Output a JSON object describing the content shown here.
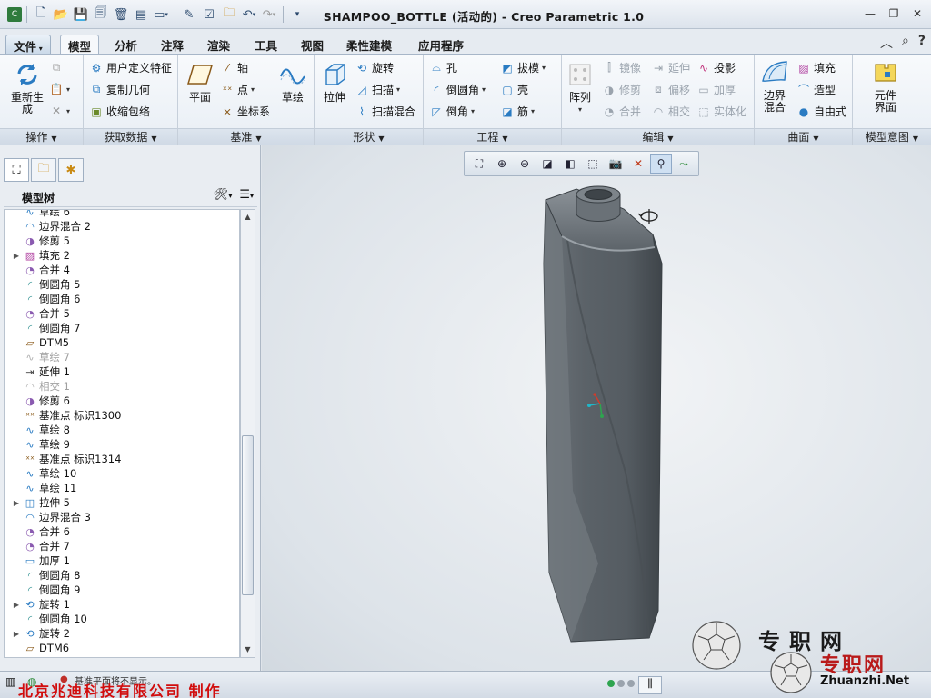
{
  "window": {
    "title": "SHAMPOO_BOTTLE (活动的) - Creo Parametric 1.0"
  },
  "tabs": {
    "file": "文件",
    "items": [
      "模型",
      "分析",
      "注释",
      "渲染",
      "工具",
      "视图",
      "柔性建模",
      "应用程序"
    ],
    "active": "模型"
  },
  "ribbon": {
    "operations": {
      "label": "操作",
      "regen": "重新生\n成"
    },
    "get_data": {
      "label": "获取数据",
      "udf": "用户定义特征",
      "copy_geom": "复制几何",
      "shrinkwrap": "收缩包络"
    },
    "datum": {
      "label": "基准",
      "plane": "平面",
      "axis": "轴",
      "point": "点",
      "csys": "坐标系",
      "sketch": "草绘"
    },
    "shapes": {
      "label": "形状",
      "extrude": "拉伸",
      "revolve": "旋转",
      "sweep": "扫描",
      "swept_blend": "扫描混合"
    },
    "engineering": {
      "label": "工程",
      "hole": "孔",
      "round": "倒圆角",
      "chamfer": "倒角",
      "draft": "拔模",
      "shell": "壳",
      "rib": "筋"
    },
    "editing": {
      "label": "编辑",
      "pattern": "阵列",
      "mirror": "镜像",
      "trim": "修剪",
      "merge": "合并",
      "extend": "延伸",
      "offset": "偏移",
      "intersect": "相交",
      "project": "投影",
      "thicken": "加厚",
      "solidify": "实体化"
    },
    "surfaces": {
      "label": "曲面",
      "boundary_blend": "边界\n混合",
      "fill": "填充",
      "style": "造型",
      "freestyle": "自由式"
    },
    "model_intent": {
      "label": "模型意图",
      "component_interface": "元件\n界面"
    }
  },
  "model_tree": {
    "title": "模型树",
    "items": [
      {
        "label": "草绘 6",
        "icon": "sketch",
        "expand": false,
        "dim": false
      },
      {
        "label": "边界混合 2",
        "icon": "boundary-blend",
        "expand": false,
        "dim": false
      },
      {
        "label": "修剪 5",
        "icon": "trim",
        "expand": false,
        "dim": false
      },
      {
        "label": "填充 2",
        "icon": "fill",
        "expand": true,
        "dim": false
      },
      {
        "label": "合并 4",
        "icon": "merge",
        "expand": false,
        "dim": false
      },
      {
        "label": "倒圆角 5",
        "icon": "round",
        "expand": false,
        "dim": false
      },
      {
        "label": "倒圆角 6",
        "icon": "round",
        "expand": false,
        "dim": false
      },
      {
        "label": "合并 5",
        "icon": "merge",
        "expand": false,
        "dim": false
      },
      {
        "label": "倒圆角 7",
        "icon": "round",
        "expand": false,
        "dim": false
      },
      {
        "label": "DTM5",
        "icon": "datum-plane",
        "expand": false,
        "dim": false
      },
      {
        "label": "草绘 7",
        "icon": "sketch",
        "expand": false,
        "dim": true
      },
      {
        "label": "延伸 1",
        "icon": "extend",
        "expand": false,
        "dim": false
      },
      {
        "label": "相交 1",
        "icon": "intersect",
        "expand": false,
        "dim": true
      },
      {
        "label": "修剪 6",
        "icon": "trim",
        "expand": false,
        "dim": false
      },
      {
        "label": "基准点 标识1300",
        "icon": "datum-point",
        "expand": false,
        "dim": false
      },
      {
        "label": "草绘 8",
        "icon": "sketch",
        "expand": false,
        "dim": false
      },
      {
        "label": "草绘 9",
        "icon": "sketch",
        "expand": false,
        "dim": false
      },
      {
        "label": "基准点 标识1314",
        "icon": "datum-point",
        "expand": false,
        "dim": false
      },
      {
        "label": "草绘 10",
        "icon": "sketch",
        "expand": false,
        "dim": false
      },
      {
        "label": "草绘 11",
        "icon": "sketch",
        "expand": false,
        "dim": false
      },
      {
        "label": "拉伸 5",
        "icon": "extrude",
        "expand": true,
        "dim": false
      },
      {
        "label": "边界混合 3",
        "icon": "boundary-blend",
        "expand": false,
        "dim": false
      },
      {
        "label": "合并 6",
        "icon": "merge",
        "expand": false,
        "dim": false
      },
      {
        "label": "合并 7",
        "icon": "merge",
        "expand": false,
        "dim": false
      },
      {
        "label": "加厚 1",
        "icon": "thicken",
        "expand": false,
        "dim": false
      },
      {
        "label": "倒圆角 8",
        "icon": "round",
        "expand": false,
        "dim": false
      },
      {
        "label": "倒圆角 9",
        "icon": "round",
        "expand": false,
        "dim": false
      },
      {
        "label": "旋转 1",
        "icon": "revolve",
        "expand": true,
        "dim": false
      },
      {
        "label": "倒圆角 10",
        "icon": "round",
        "expand": false,
        "dim": false
      },
      {
        "label": "旋转 2",
        "icon": "revolve",
        "expand": true,
        "dim": false
      },
      {
        "label": "DTM6",
        "icon": "datum-plane",
        "expand": false,
        "dim": false
      }
    ]
  },
  "status": {
    "message": "基准平面将不显示。",
    "company": "北京兆迪科技有限公司 制作"
  },
  "watermark": {
    "line1": "专职网",
    "line2": "专职网",
    "site": "Zhuanzhi.Net"
  },
  "colors": {
    "accent": "#2c5f9e",
    "company_red": "#d10d0d",
    "bottle": "#5a6167"
  }
}
